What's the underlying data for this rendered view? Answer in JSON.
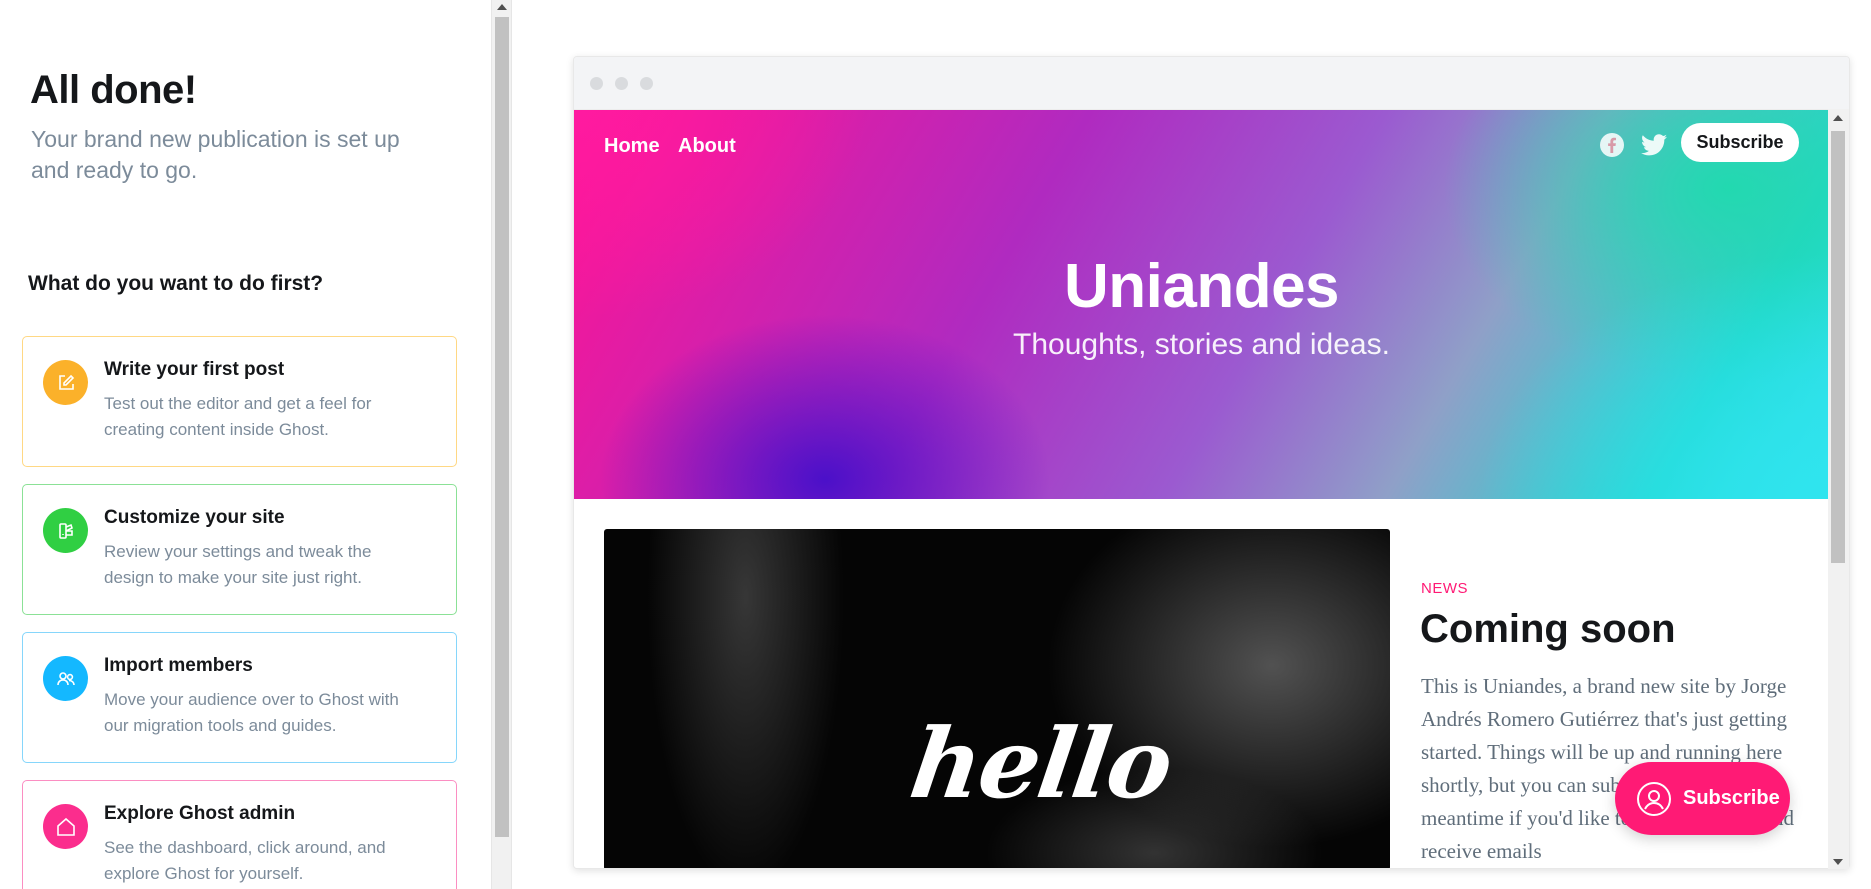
{
  "setup": {
    "title": "All done!",
    "subtitle": "Your brand new publication is set up and ready to go.",
    "question": "What do you want to do first?",
    "cards": [
      {
        "title": "Write your first post",
        "desc": "Test out the editor and get a feel for creating content inside Ghost.",
        "icon": "pencil-icon",
        "color": "#fbb12a"
      },
      {
        "title": "Customize your site",
        "desc": "Review your settings and tweak the design to make your site just right.",
        "icon": "brush-icon",
        "color": "#30cf43"
      },
      {
        "title": "Import members",
        "desc": "Move your audience over to Ghost with our migration tools and guides.",
        "icon": "users-icon",
        "color": "#14b8ff"
      },
      {
        "title": "Explore Ghost admin",
        "desc": "See the dashboard, click around, and explore Ghost for yourself.",
        "icon": "home-icon",
        "color": "#fb2d8d"
      }
    ]
  },
  "preview": {
    "nav": {
      "home": "Home",
      "about": "About",
      "subscribe": "Subscribe"
    },
    "site_title": "Uniandes",
    "tagline": "Thoughts, stories and ideas.",
    "image_text": "hello",
    "post": {
      "tag": "NEWS",
      "title": "Coming soon",
      "excerpt": "This is Uniandes, a brand new site by Jorge Andrés Romero Gutiérrez that's just getting started. Things will be up and running here shortly, but you can subscribe in the meantime if you'd like to stay up to date and receive emails"
    },
    "portal_button": "Subscribe",
    "accent": "#ff1a75"
  }
}
